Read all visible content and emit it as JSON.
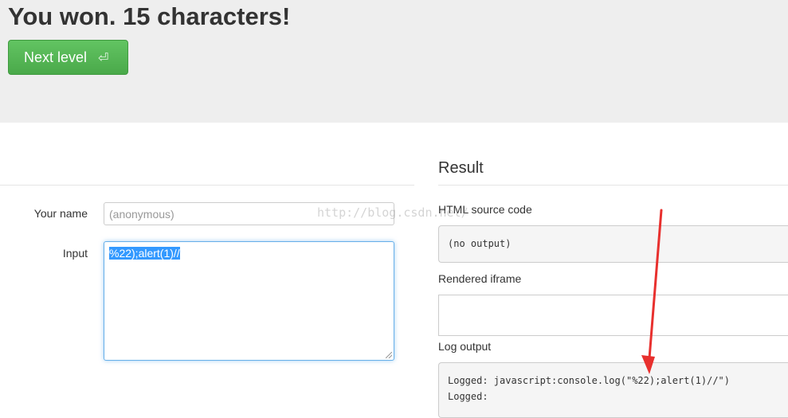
{
  "header": {
    "title": "You won. 15 characters!",
    "next_button_label": "Next level",
    "next_button_icon": "enter-icon"
  },
  "form": {
    "name_label": "Your name",
    "name_placeholder": "(anonymous)",
    "input_label": "Input",
    "input_value": "%22);alert(1)//"
  },
  "result": {
    "title": "Result",
    "html_source_label": "HTML source code",
    "html_source_value": "(no output)",
    "rendered_iframe_label": "Rendered iframe",
    "log_output_label": "Log output",
    "log_lines": [
      "Logged: javascript:console.log(\"%22);alert(1)//\")",
      "Logged:"
    ]
  },
  "watermark": "http://blog.csdn.net/",
  "colors": {
    "accent_green": "#5cb85c",
    "selection_blue": "#3399ff",
    "annotation_red": "#e8302e"
  }
}
